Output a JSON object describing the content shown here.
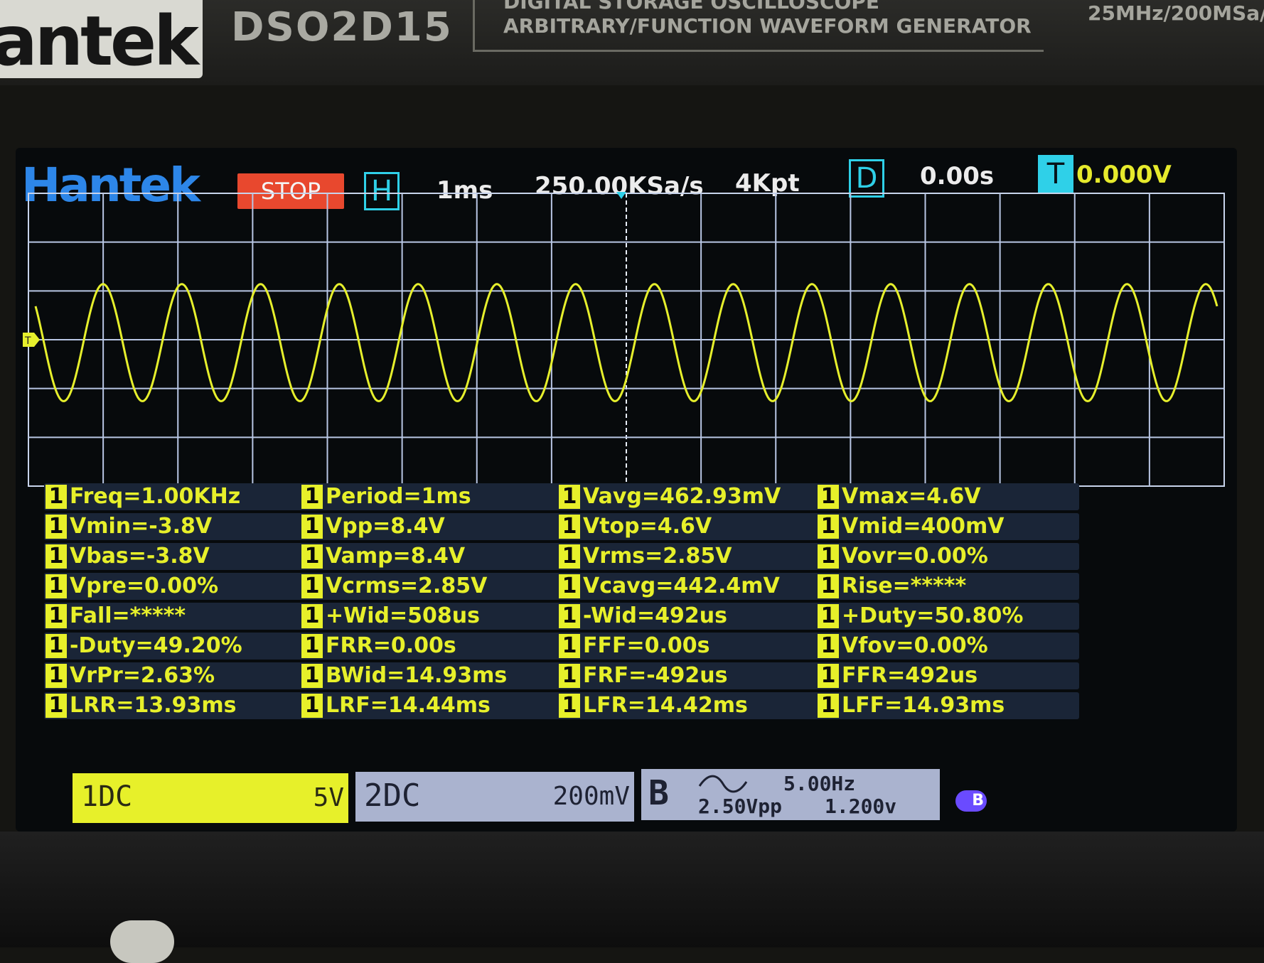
{
  "device": {
    "brand": "antek",
    "model": "DSO2D15",
    "description_line1": "DIGITAL STORAGE OSCILLOSCOPE",
    "description_line2": "ARBITRARY/FUNCTION WAVEFORM GENERATOR",
    "spec": "25MHz/200MSa/"
  },
  "header": {
    "logo": "Hantek",
    "run_state": "STOP",
    "h_label": "H",
    "timebase": "1ms",
    "sample_rate": "250.00KSa/s",
    "memory_depth": "4Kpt",
    "d_label": "D",
    "delay": "0.00s",
    "t_label": "T",
    "trigger_level": "0.000V"
  },
  "waveform": {
    "channel": "1",
    "trigger_marker": "T",
    "color": "#e6ef2c",
    "cycles_visible": 15,
    "peak_fraction": 0.69,
    "trough_fraction": 0.29
  },
  "measurements": [
    [
      "Freq=1.00KHz",
      "Period=1ms",
      "Vavg=462.93mV",
      "Vmax=4.6V"
    ],
    [
      "Vmin=-3.8V",
      "Vpp=8.4V",
      "Vtop=4.6V",
      "Vmid=400mV"
    ],
    [
      "Vbas=-3.8V",
      "Vamp=8.4V",
      "Vrms=2.85V",
      "Vovr=0.00%"
    ],
    [
      "Vpre=0.00%",
      "Vcrms=2.85V",
      "Vcavg=442.4mV",
      "Rise=*****"
    ],
    [
      "Fall=*****",
      "+Wid=508us",
      "-Wid=492us",
      "+Duty=50.80%"
    ],
    [
      "-Duty=49.20%",
      "FRR=0.00s",
      "FFF=0.00s",
      "Vfov=0.00%"
    ],
    [
      "VrPr=2.63%",
      "BWid=14.93ms",
      "FRF=-492us",
      "FFR=492us"
    ],
    [
      "LRR=13.93ms",
      "LRF=14.44ms",
      "LFR=14.42ms",
      "LFF=14.93ms"
    ]
  ],
  "measure_channel": "1",
  "channels": {
    "ch1": {
      "label": "1DC",
      "scale": "5V"
    },
    "ch2": {
      "label": "2DC",
      "scale": "200mV"
    },
    "gen": {
      "label": "B",
      "frequency": "5.00Hz",
      "amplitude": "2.50Vpp",
      "offset": "1.200v"
    },
    "usb_badge": "B"
  }
}
